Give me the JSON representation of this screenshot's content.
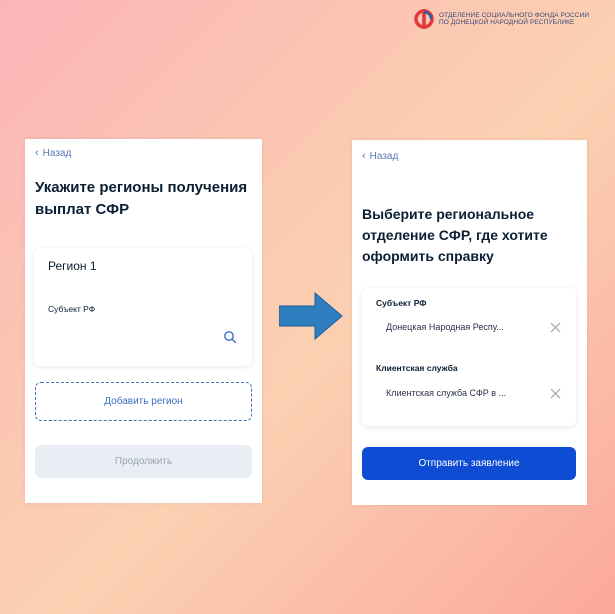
{
  "logo": {
    "line1": "ОТДЕЛЕНИЕ СОЦИАЛЬНОГО ФОНДА РОССИИ",
    "line2": "ПО ДОНЕЦКОЙ НАРОДНОЙ РЕСПУБЛИКЕ",
    "icon": "sfr-logo-icon"
  },
  "colors": {
    "accent": "#0d4cd3",
    "link": "#5a79b8",
    "arrow": "#2f7fc0"
  },
  "screen1": {
    "back_label": "Назад",
    "heading_line1": "Укажите регионы получения",
    "heading_line2": "выплат СФР",
    "region_card": {
      "title": "Регион 1",
      "field_label": "Субъект РФ",
      "field_value": "",
      "icon": "search-icon"
    },
    "add_region_label": "Добавить регион",
    "continue_label": "Продолжить"
  },
  "screen2": {
    "back_label": "Назад",
    "heading_line1": "Выберите региональное",
    "heading_line2": "отделение СФР, где хотите",
    "heading_line3": "оформить справку",
    "subject": {
      "label": "Субъект РФ",
      "value": "Донецкая Народная Респу...",
      "icon": "clear-icon"
    },
    "service": {
      "label": "Клиентская служба",
      "value": "Клиентская служба СФР в ...",
      "icon": "clear-icon"
    },
    "submit_label": "Отправить заявление"
  }
}
